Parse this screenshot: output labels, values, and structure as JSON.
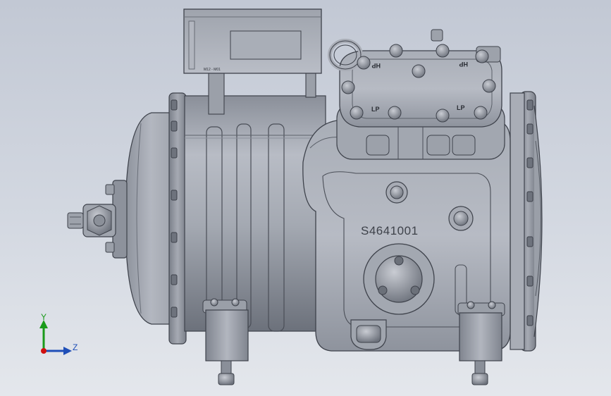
{
  "model": {
    "serial_marking": "S4641001",
    "nameplate_text": "M12 - M01",
    "head_labels": {
      "hp_left": "HP",
      "hp_right": "HP",
      "lp_left": "LP",
      "lp_right": "LP"
    }
  },
  "triad": {
    "y_label": "Y",
    "z_label": "Z"
  },
  "colors": {
    "background_top": "#c2c8d4",
    "background_bottom": "#e4e7ec",
    "metal_light": "#b4b8c1",
    "metal_mid": "#8f949e",
    "metal_dark": "#4a4e57",
    "y_axis": "#1a9a1a",
    "z_axis": "#1f4fb8",
    "origin": "#d01010"
  }
}
